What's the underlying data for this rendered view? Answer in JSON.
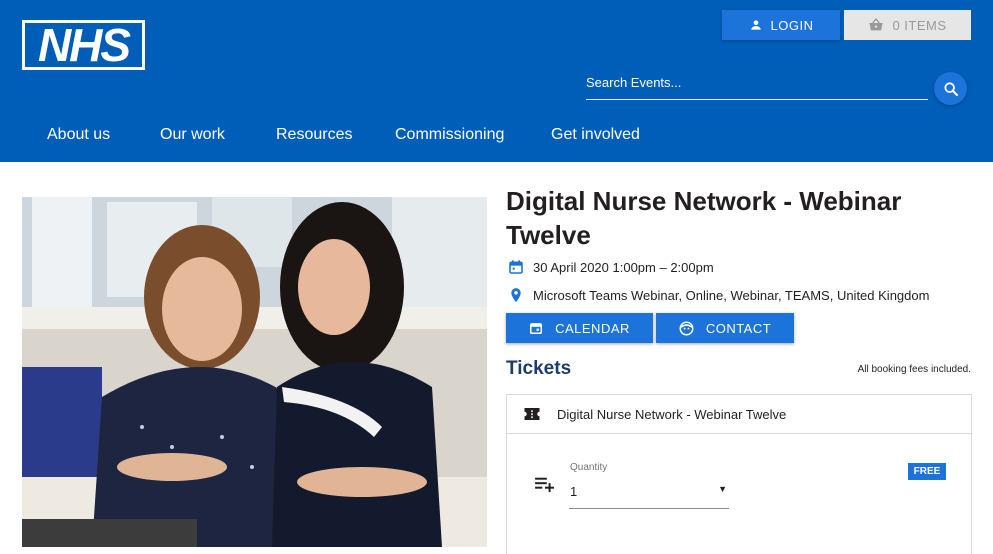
{
  "header": {
    "logo_text": "NHS",
    "login_label": "LOGIN",
    "cart_label": "0 ITEMS",
    "search_placeholder": "Search Events..."
  },
  "nav": {
    "items": [
      {
        "label": "About us"
      },
      {
        "label": "Our work"
      },
      {
        "label": "Resources"
      },
      {
        "label": "Commissioning"
      },
      {
        "label": "Get involved"
      }
    ]
  },
  "event": {
    "title": "Digital Nurse Network - Webinar Twelve",
    "date_time": "30 April 2020 1:00pm – 2:00pm",
    "location": "Microsoft Teams Webinar, Online, Webinar, TEAMS, United Kingdom",
    "calendar_label": "CALENDAR",
    "contact_label": "CONTACT"
  },
  "tickets": {
    "heading": "Tickets",
    "fees_note": "All booking fees included.",
    "items": [
      {
        "name": "Digital Nurse Network - Webinar Twelve",
        "quantity_label": "Quantity",
        "quantity_value": "1",
        "price_badge": "FREE"
      }
    ]
  },
  "colors": {
    "nhs_blue": "#005eb8",
    "button_blue": "#1c73d9",
    "heading_navy": "#1a3c6e"
  },
  "icons": [
    "person-icon",
    "basket-icon",
    "search-icon",
    "calendar-icon",
    "location-pin-icon",
    "face-icon",
    "ticket-icon",
    "playlist-add-icon",
    "dropdown-arrow-icon"
  ]
}
